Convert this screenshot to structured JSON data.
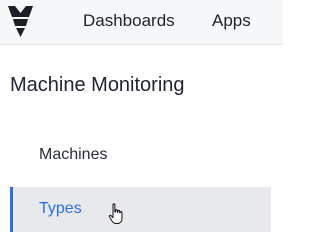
{
  "header": {
    "nav": [
      {
        "label": "Dashboards"
      },
      {
        "label": "Apps"
      }
    ]
  },
  "sidebar": {
    "title": "Machine Monitoring",
    "items": [
      {
        "label": "Machines",
        "active": false
      },
      {
        "label": "Types",
        "active": true
      }
    ]
  },
  "colors": {
    "accent": "#2f6ede",
    "active_bg": "#e8e9ec"
  },
  "icons": {
    "logo": "tulip-logo-icon",
    "cursor": "hand-pointer-cursor"
  }
}
